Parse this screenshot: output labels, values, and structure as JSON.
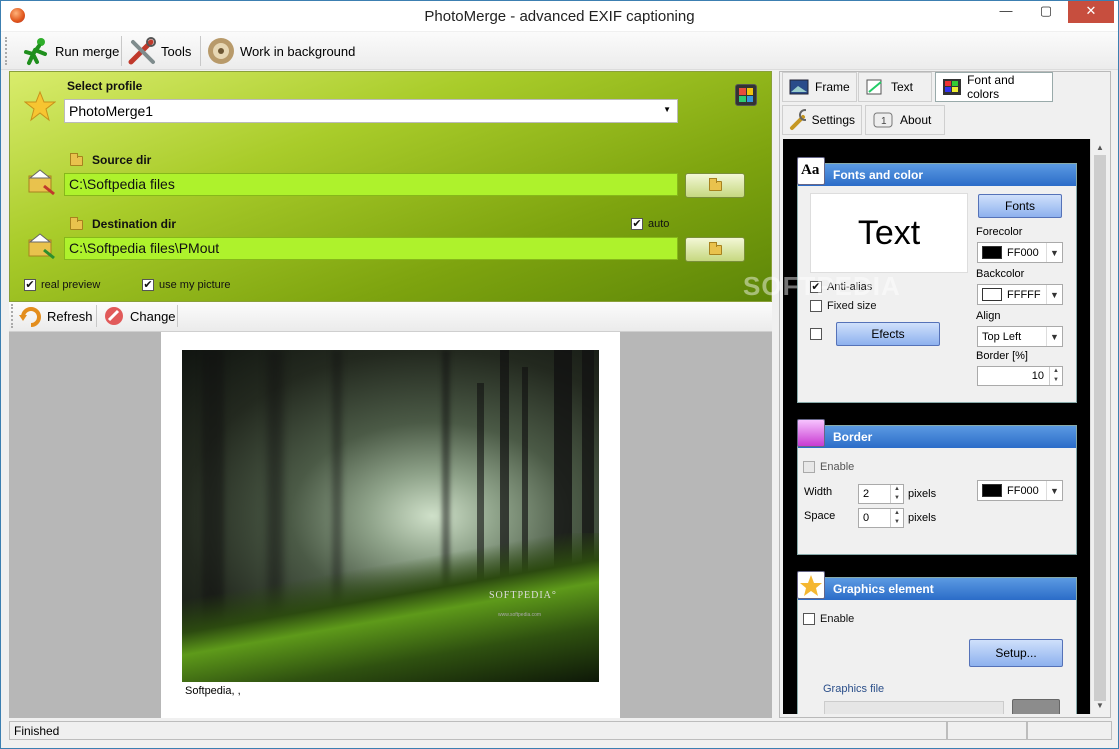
{
  "window": {
    "title": "PhotoMerge - advanced EXIF captioning",
    "min": "—",
    "max": "▢",
    "close": "✕"
  },
  "toolbar": {
    "run_merge": "Run merge",
    "tools": "Tools",
    "work_bg": "Work in background"
  },
  "profile": {
    "label": "Select profile",
    "value": "PhotoMerge1"
  },
  "source": {
    "label": "Source dir",
    "value": "C:\\Softpedia files"
  },
  "dest": {
    "label": "Destination dir",
    "value": "C:\\Softpedia files\\PMout",
    "auto_label": "auto",
    "auto_checked": "✔"
  },
  "options": {
    "real_preview": "real preview",
    "use_picture": "use my picture",
    "check": "✔"
  },
  "actions": {
    "refresh": "Refresh",
    "change": "Change"
  },
  "preview": {
    "caption": "Softpedia, ,",
    "photo_logo": "SOFTPEDIA°",
    "photo_url": "www.softpedia.com"
  },
  "tabs": {
    "frame": "Frame",
    "text": "Text",
    "font_colors": "Font and colors",
    "settings": "Settings",
    "about": "About"
  },
  "fonts": {
    "title": "Fonts and color",
    "sample": "Text",
    "fonts_btn": "Fonts",
    "forecolor_label": "Forecolor",
    "forecolor": "FF000",
    "backcolor_label": "Backcolor",
    "backcolor": "FFFFF",
    "align_label": "Align",
    "align": "Top Left",
    "border_label": "Border [%]",
    "border": "10",
    "antialias": "Anti-alias",
    "fixed": "Fixed size",
    "efects": "Efects",
    "check": "✔"
  },
  "border": {
    "title": "Border",
    "enable": "Enable",
    "width_label": "Width",
    "width": "2",
    "space_label": "Space",
    "space": "0",
    "pixels": "pixels",
    "color": "FF000"
  },
  "graphics": {
    "title": "Graphics element",
    "enable": "Enable",
    "setup": "Setup...",
    "file_label": "Graphics file"
  },
  "status": {
    "text": "Finished"
  },
  "colors": {
    "accent_green": "#a9cc2a",
    "input_green": "#aef22c",
    "section_blue": "#2b6cc8"
  },
  "watermark": "SOFTPEDIA"
}
